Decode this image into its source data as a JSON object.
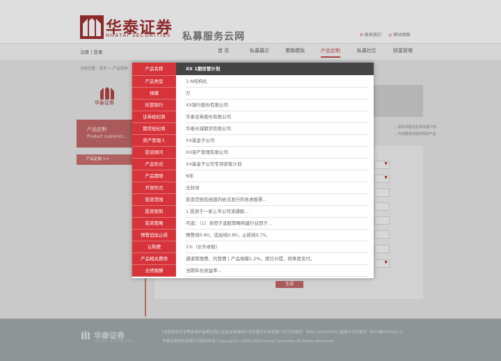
{
  "header": {
    "brand_cn": "华泰证券",
    "brand_en": "HUATAI SECURITIES",
    "portal_name": "私募服务云网",
    "links": [
      "联系我们",
      "网站地图"
    ]
  },
  "nav": {
    "auth": "注册 | 登录",
    "items": [
      "首 页",
      "私募展示",
      "策略模拟",
      "产品定制",
      "私募社区",
      "财富管理"
    ],
    "active_index": 3
  },
  "breadcrumb": "当前位置：首页 > 产品定制",
  "sidebar": {
    "logo_text": "华泰证券",
    "title": "产品定制",
    "subtitle": "Product customiz...",
    "menu_item": "产品定制 >>"
  },
  "right_panel": {
    "line1": "...资料并提交后将由客户经...",
    "line2": "...与您联系并提供相关产品"
  },
  "form": {
    "submit_label": "生成"
  },
  "modal": {
    "rows": [
      {
        "key": "产品名称",
        "value": "XX 1期信管计划"
      },
      {
        "key": "产品类型",
        "value": "1:N结构化"
      },
      {
        "key": "规模",
        "value": "万"
      },
      {
        "key": "托管银行",
        "value": "XX银行股份有限公司"
      },
      {
        "key": "证券经纪商",
        "value": "华泰证券股份有限公司"
      },
      {
        "key": "期货经纪商",
        "value": "华泰长城期货有限公司"
      },
      {
        "key": "资产管理人",
        "value": "XX基金子公司"
      },
      {
        "key": "投资顾问",
        "value": "XX资产管理有限公司"
      },
      {
        "key": "产品形式",
        "value": "XX基金子公司专项资管计划"
      },
      {
        "key": "产品期限",
        "value": "N年"
      },
      {
        "key": "开放形式",
        "value": "全封闭"
      },
      {
        "key": "投资范围",
        "value": "投资范围包括国内依法发行的各类股票..."
      },
      {
        "key": "投资限制",
        "value": "1.投资于一家上市公司流通股..."
      },
      {
        "key": "投资策略",
        "value": "可选：（1）多因子选股策略构建行业因子..."
      },
      {
        "key": "预警追加止损",
        "value": "预警线0.80，追加线0.80，止损线0.75。"
      },
      {
        "key": "认购费",
        "value": "1%（价外收取）"
      },
      {
        "key": "产品相关费用",
        "value": "通道管理费、托管费   |   产品规模1.2%，按日计提，按季度支付。"
      },
      {
        "key": "业绩报酬",
        "value": "当期年化收益率..."
      }
    ]
  },
  "footer": {
    "brand_cn": "华泰证券",
    "brand_en": "HUATAI SECURITIES",
    "line1": "[信息系统安全等级保护备案证明]   [证监会核准网上证券委托业务资格]   [许可证编号：苏B2-20040078]   [备案许可证编号: 苏ICP备05002S-1]",
    "line2": "华泰证券股份有限公司版权所有     Copyright© 2008-2009 Huatai Securities All Rights Reserved"
  },
  "colors": {
    "accent": "#d6333a",
    "brand": "#8c2a2a"
  }
}
